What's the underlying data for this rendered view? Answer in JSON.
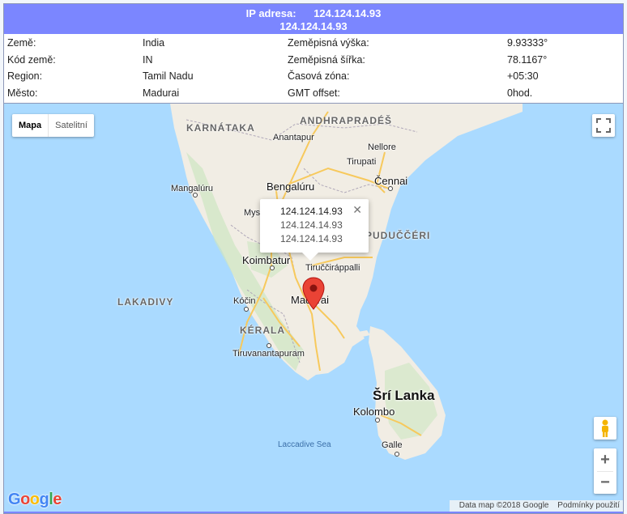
{
  "header": {
    "label": "IP adresa:",
    "ip_primary": "124.124.14.93",
    "ip_secondary": "124.124.14.93"
  },
  "info": {
    "rows": [
      {
        "k1": "Země:",
        "v1": "India",
        "k2": "Zeměpisná výška:",
        "v2": "9.93333°"
      },
      {
        "k1": "Kód země:",
        "v1": "IN",
        "k2": "Zeměpisná šířka:",
        "v2": "78.1167°"
      },
      {
        "k1": "Region:",
        "v1": "Tamil Nadu",
        "k2": "Časová zóna:",
        "v2": "+05:30"
      },
      {
        "k1": "Město:",
        "v1": "Madurai",
        "k2": "GMT offset:",
        "v2": "0hod."
      }
    ]
  },
  "map": {
    "type_control": {
      "map": "Mapa",
      "satellite": "Satelitní"
    },
    "infowindow": {
      "line1": "124.124.14.93",
      "line2": "124.124.14.93",
      "line3": "124.124.14.93",
      "close": "✕"
    },
    "labels": {
      "karnataka": "KARNÁTAKA",
      "andhra": "ANDHRAPRADÉŠ",
      "anantapur": "Anantapur",
      "nellore": "Nellore",
      "tirupati": "Tirupati",
      "chennai": "Čennai",
      "bengaluru": "Bengalúru",
      "mangaluru": "Mangalúru",
      "mysuru": "Mys",
      "puducherry": "PUDUČČÉRI",
      "koimbatur": "Koimbatur",
      "tiruchirappalli": "Tiruččiráppalli",
      "lakadivy": "LAKADIVY",
      "kochi": "Kóčin",
      "madurai": "Madurai",
      "kerala": "KÉRALA",
      "tiruvanantapuram": "Tiruvanantapuram",
      "srilanka": "Šrí Lanka",
      "kolombo": "Kolombo",
      "laccadive": "Laccadive Sea",
      "galle": "Galle"
    },
    "google_logo": "Google",
    "attribution": {
      "data": "Data map ©2018 Google",
      "terms": "Podmínky použití"
    },
    "zoom": {
      "in": "+",
      "out": "−"
    }
  },
  "colors": {
    "header": "#7b86ff",
    "water": "#aadaff",
    "land": "#f1ede4",
    "marker": "#ea4335"
  }
}
